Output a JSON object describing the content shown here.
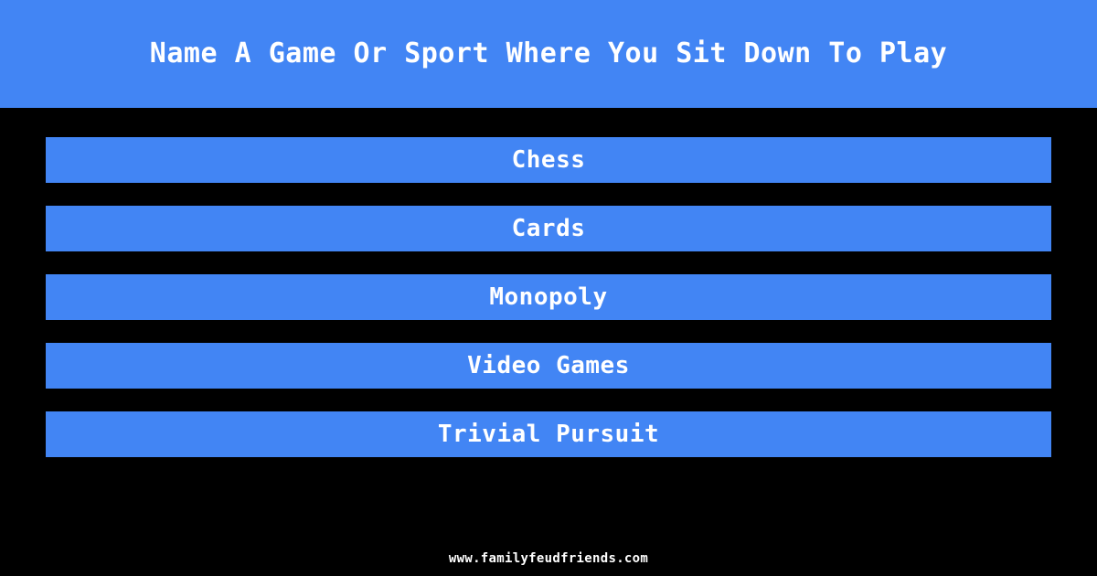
{
  "header": {
    "title": "Name A Game Or Sport Where You Sit Down To Play",
    "background_color": "#4285f4",
    "text_color": "#ffffff"
  },
  "answers": {
    "bar_color": "#4285f4",
    "text_color": "#ffffff",
    "items": [
      {
        "rank": 1,
        "label": "Chess"
      },
      {
        "rank": 2,
        "label": "Cards"
      },
      {
        "rank": 3,
        "label": "Monopoly"
      },
      {
        "rank": 4,
        "label": "Video Games"
      },
      {
        "rank": 5,
        "label": "Trivial Pursuit"
      }
    ]
  },
  "footer": {
    "url": "www.familyfeudfriends.com",
    "text_color": "#ffffff"
  },
  "page": {
    "background_color": "#000000"
  }
}
